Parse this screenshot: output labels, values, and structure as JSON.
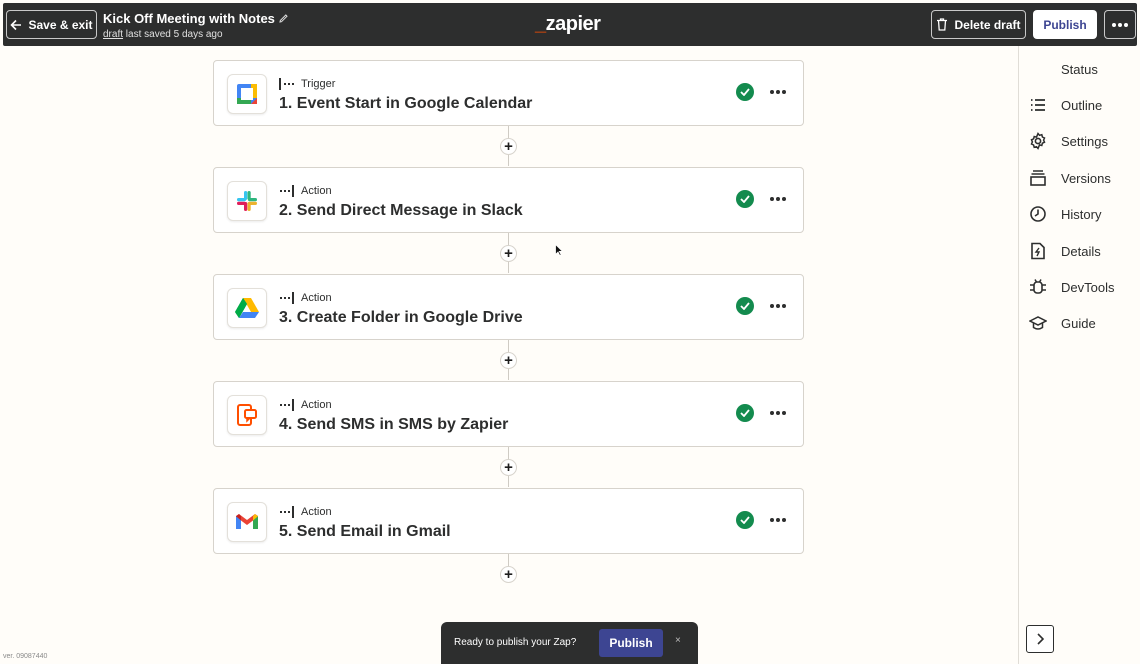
{
  "header": {
    "save_exit_label": "Save & exit",
    "zap_title": "Kick Off Meeting with Notes",
    "status_link": "draft",
    "saved_text": "last saved 5 days ago",
    "logo_text": "zapier",
    "delete_draft_label": "Delete draft",
    "publish_label": "Publish"
  },
  "sidebar": {
    "status_label": "Status",
    "items": [
      {
        "label": "Outline",
        "icon": "list-icon"
      },
      {
        "label": "Settings",
        "icon": "gear-icon"
      },
      {
        "label": "Versions",
        "icon": "stack-icon"
      },
      {
        "label": "History",
        "icon": "clock-icon"
      },
      {
        "label": "Details",
        "icon": "file-bolt-icon"
      },
      {
        "label": "DevTools",
        "icon": "bug-icon"
      },
      {
        "label": "Guide",
        "icon": "graduation-cap-icon"
      }
    ]
  },
  "steps": [
    {
      "kind": "Trigger",
      "title": "1. Event Start in Google Calendar",
      "app": "google-calendar-icon",
      "status": "complete"
    },
    {
      "kind": "Action",
      "title": "2. Send Direct Message in Slack",
      "app": "slack-icon",
      "status": "complete"
    },
    {
      "kind": "Action",
      "title": "3. Create Folder in Google Drive",
      "app": "google-drive-icon",
      "status": "complete"
    },
    {
      "kind": "Action",
      "title": "4. Send SMS in SMS by Zapier",
      "app": "sms-by-zapier-icon",
      "status": "complete"
    },
    {
      "kind": "Action",
      "title": "5. Send Email in Gmail",
      "app": "gmail-icon",
      "status": "complete"
    }
  ],
  "toast": {
    "message": "Ready to publish your Zap?",
    "publish_label": "Publish",
    "close_glyph": "×"
  },
  "footer": {
    "version": "ver. 09087440"
  },
  "colors": {
    "brand_orange": "#ff4f00",
    "publish_blue": "#3d4592",
    "success_green": "#138b4e",
    "topbar": "#2d2e2e"
  }
}
